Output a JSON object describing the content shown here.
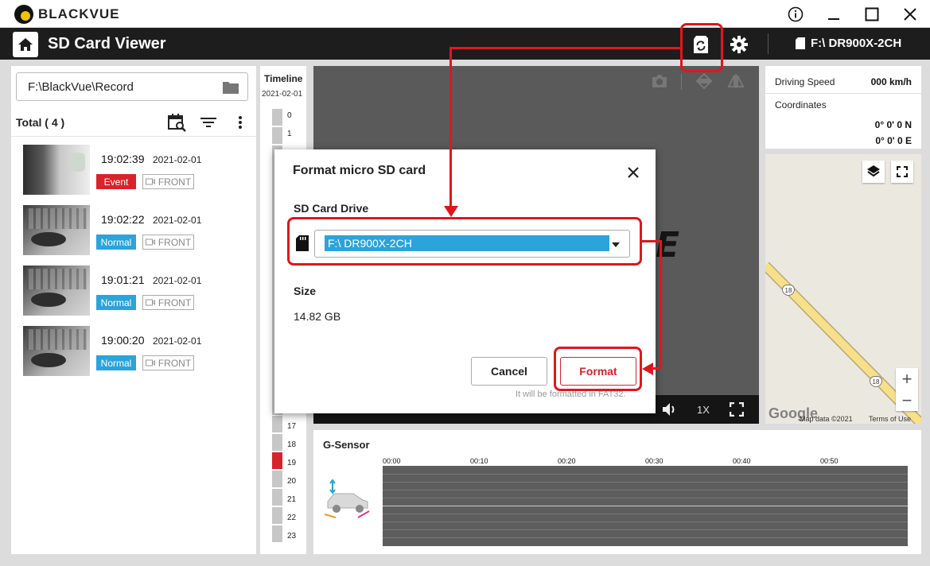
{
  "window": {
    "brand": "BLACKVUE",
    "controls": [
      "info-icon",
      "minimize-icon",
      "maximize-icon",
      "close-icon"
    ]
  },
  "header": {
    "title": "SD Card Viewer",
    "device": "F:\\ DR900X-2CH",
    "icons": [
      "home-icon",
      "sd-format-icon",
      "gear-icon",
      "sd-card-icon"
    ]
  },
  "sidebar": {
    "path": "F:\\BlackVue\\Record",
    "total": "Total ( 4 )",
    "recordings": [
      {
        "time": "19:02:39",
        "date": "2021-02-01",
        "type": "Event",
        "camera": "FRONT"
      },
      {
        "time": "19:02:22",
        "date": "2021-02-01",
        "type": "Normal",
        "camera": "FRONT"
      },
      {
        "time": "19:01:21",
        "date": "2021-02-01",
        "type": "Normal",
        "camera": "FRONT"
      },
      {
        "time": "19:00:20",
        "date": "2021-02-01",
        "type": "Normal",
        "camera": "FRONT"
      }
    ]
  },
  "timeline": {
    "title": "Timeline",
    "date": "2021-02-01",
    "hours_top": [
      "0",
      "1"
    ],
    "hours_bottom": [
      "17",
      "18",
      "19",
      "20",
      "21",
      "22",
      "23"
    ],
    "active_hour": "19"
  },
  "video": {
    "speed_label": "1X",
    "status_colors": {
      "event": "#d8232a",
      "normal": "#2ba3db"
    }
  },
  "info": {
    "driving_speed_label": "Driving Speed",
    "driving_speed_value": "000 km/h",
    "coordinates_label": "Coordinates",
    "lat": "0° 0'   0 N",
    "lon": "0° 0'   0 E"
  },
  "map": {
    "route": "18",
    "zoom_in": "+",
    "zoom_out": "−",
    "logo": "Google",
    "attribution": "Map data ©2021",
    "terms": "Terms of Use"
  },
  "gsensor": {
    "title": "G-Sensor",
    "ticks": [
      "00:00",
      "00:10",
      "00:20",
      "00:30",
      "00:40",
      "00:50"
    ]
  },
  "modal": {
    "title": "Format micro SD card",
    "drive_label": "SD Card Drive",
    "drive_value": "F:\\ DR900X-2CH",
    "size_label": "Size",
    "size_value": "14.82 GB",
    "cancel_label": "Cancel",
    "format_label": "Format",
    "note": "It will be formatted in FAT32."
  },
  "annotation_color": "#e0161f"
}
